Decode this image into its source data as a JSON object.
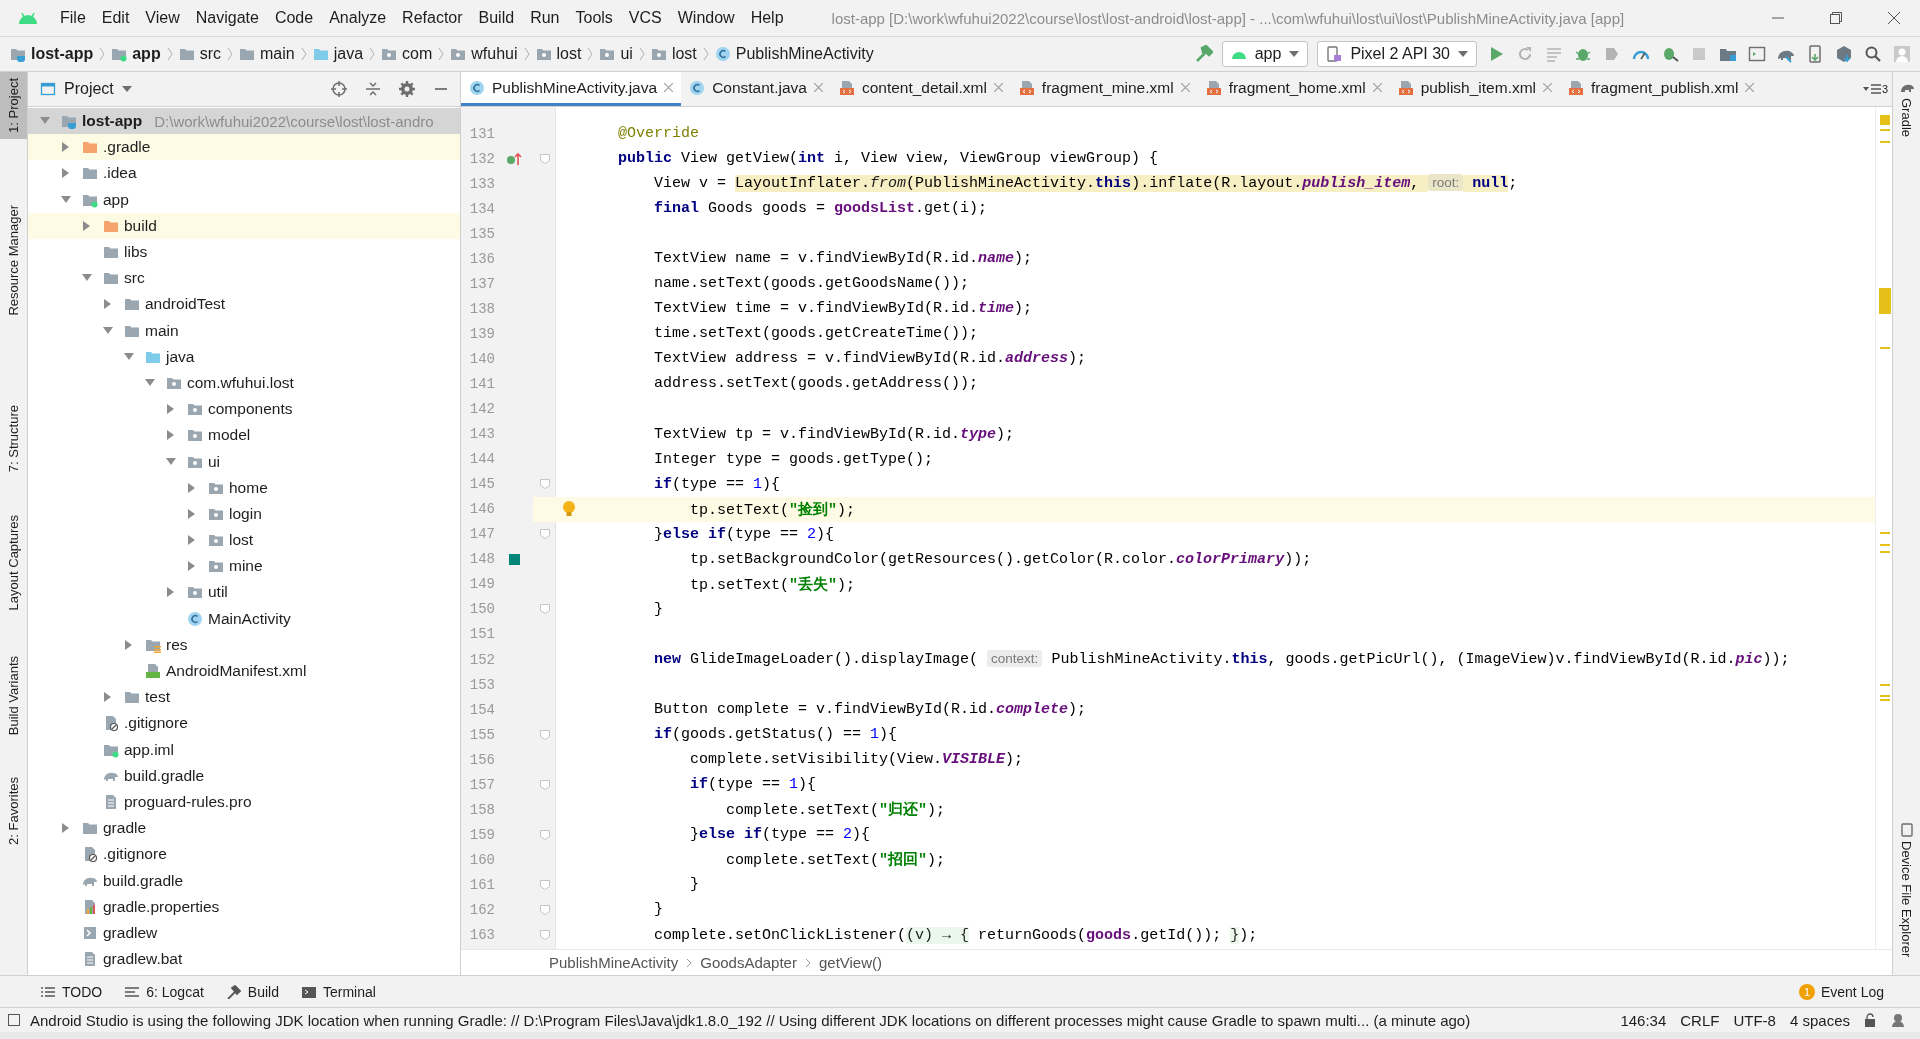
{
  "menu_bar": {
    "items": [
      "File",
      "Edit",
      "View",
      "Navigate",
      "Code",
      "Analyze",
      "Refactor",
      "Build",
      "Run",
      "Tools",
      "VCS",
      "Window",
      "Help"
    ],
    "title": "lost-app [D:\\work\\wfuhui2022\\course\\lost\\lost-android\\lost-app] - ...\\com\\wfuhui\\lost\\ui\\lost\\PublishMineActivity.java [app]"
  },
  "nav_bar": {
    "crumbs": [
      {
        "label": "lost-app",
        "kind": "module-root"
      },
      {
        "label": "app",
        "kind": "module"
      },
      {
        "label": "src",
        "kind": "folder"
      },
      {
        "label": "main",
        "kind": "folder"
      },
      {
        "label": "java",
        "kind": "source"
      },
      {
        "label": "com",
        "kind": "package"
      },
      {
        "label": "wfuhui",
        "kind": "package"
      },
      {
        "label": "lost",
        "kind": "package"
      },
      {
        "label": "ui",
        "kind": "package"
      },
      {
        "label": "lost",
        "kind": "package"
      },
      {
        "label": "PublishMineActivity",
        "kind": "class"
      }
    ],
    "run_config": "app",
    "device": "Pixel 2 API 30"
  },
  "left_stripe": [
    {
      "label": "1: Project",
      "selected": true
    },
    {
      "label": "Resource Manager",
      "selected": false
    },
    {
      "label": "7: Structure",
      "selected": false
    },
    {
      "label": "Layout Captures",
      "selected": false
    },
    {
      "label": "Build Variants",
      "selected": false
    },
    {
      "label": "2: Favorites",
      "selected": false
    }
  ],
  "project_panel": {
    "title": "Project",
    "tree": [
      {
        "label": "lost-app",
        "path": "D:\\work\\wfuhui2022\\course\\lost\\lost-andro",
        "kind": "module-root",
        "expanded": true,
        "selected": true,
        "children": [
          {
            "label": ".gradle",
            "kind": "excluded",
            "expanded": false,
            "selected": false
          },
          {
            "label": ".idea",
            "kind": "folder",
            "expanded": false,
            "selected": false
          },
          {
            "label": "app",
            "kind": "module",
            "expanded": true,
            "selected": false,
            "children": [
              {
                "label": "build",
                "kind": "excluded",
                "expanded": false,
                "selected": false
              },
              {
                "label": "libs",
                "kind": "folder",
                "selected": false
              },
              {
                "label": "src",
                "kind": "folder",
                "expanded": true,
                "selected": false,
                "children": [
                  {
                    "label": "androidTest",
                    "kind": "folder",
                    "expanded": false,
                    "selected": false
                  },
                  {
                    "label": "main",
                    "kind": "folder",
                    "expanded": true,
                    "selected": false,
                    "children": [
                      {
                        "label": "java",
                        "kind": "source",
                        "expanded": true,
                        "selected": false,
                        "children": [
                          {
                            "label": "com.wfuhui.lost",
                            "kind": "package",
                            "expanded": true,
                            "selected": false,
                            "children": [
                              {
                                "label": "components",
                                "kind": "package",
                                "expanded": false,
                                "selected": false
                              },
                              {
                                "label": "model",
                                "kind": "package",
                                "expanded": false,
                                "selected": false
                              },
                              {
                                "label": "ui",
                                "kind": "package",
                                "expanded": true,
                                "selected": false,
                                "children": [
                                  {
                                    "label": "home",
                                    "kind": "package",
                                    "expanded": false,
                                    "selected": false
                                  },
                                  {
                                    "label": "login",
                                    "kind": "package",
                                    "expanded": false,
                                    "selected": false
                                  },
                                  {
                                    "label": "lost",
                                    "kind": "package",
                                    "expanded": false,
                                    "selected": false
                                  },
                                  {
                                    "label": "mine",
                                    "kind": "package",
                                    "expanded": false,
                                    "selected": false
                                  }
                                ]
                              },
                              {
                                "label": "util",
                                "kind": "package",
                                "expanded": false,
                                "selected": false
                              },
                              {
                                "label": "MainActivity",
                                "kind": "class",
                                "selected": false
                              }
                            ]
                          }
                        ]
                      },
                      {
                        "label": "res",
                        "kind": "res",
                        "expanded": false,
                        "selected": false
                      },
                      {
                        "label": "AndroidManifest.xml",
                        "kind": "manifest",
                        "selected": false
                      }
                    ]
                  },
                  {
                    "label": "test",
                    "kind": "folder",
                    "expanded": false,
                    "selected": false
                  }
                ]
              },
              {
                "label": ".gitignore",
                "kind": "gitignore",
                "selected": false
              },
              {
                "label": "app.iml",
                "kind": "iml",
                "selected": false
              },
              {
                "label": "build.gradle",
                "kind": "gradle",
                "selected": false
              },
              {
                "label": "proguard-rules.pro",
                "kind": "text",
                "selected": false
              }
            ]
          },
          {
            "label": "gradle",
            "kind": "folder",
            "expanded": false,
            "selected": false
          },
          {
            "label": ".gitignore",
            "kind": "gitignore",
            "selected": false
          },
          {
            "label": "build.gradle",
            "kind": "gradle",
            "selected": false
          },
          {
            "label": "gradle.properties",
            "kind": "properties",
            "selected": false
          },
          {
            "label": "gradlew",
            "kind": "script",
            "selected": false
          },
          {
            "label": "gradlew.bat",
            "kind": "text",
            "selected": false
          }
        ]
      }
    ]
  },
  "editor": {
    "tabs": [
      {
        "label": "PublishMineActivity.java",
        "kind": "class",
        "selected": true
      },
      {
        "label": "Constant.java",
        "kind": "class",
        "selected": false
      },
      {
        "label": "content_detail.xml",
        "kind": "xml",
        "selected": false
      },
      {
        "label": "fragment_mine.xml",
        "kind": "xml",
        "selected": false
      },
      {
        "label": "fragment_home.xml",
        "kind": "xml",
        "selected": false
      },
      {
        "label": "publish_item.xml",
        "kind": "xml",
        "selected": false
      },
      {
        "label": "fragment_publish.xml",
        "kind": "xml",
        "selected": false
      }
    ],
    "tab_overflow": "3",
    "lines": [
      {
        "number": "131",
        "tokens": [
          {
            "kind": "annotation",
            "text": "    @Override"
          }
        ]
      },
      {
        "number": "132",
        "gutter_icon": {
          "kind": "override"
        },
        "fold": true,
        "tokens": [
          {
            "kind": "keyword",
            "text": "    public"
          },
          {
            "kind": "plain",
            "text": " View getView("
          },
          {
            "kind": "keyword",
            "text": "int"
          },
          {
            "kind": "plain",
            "text": " i, View view, ViewGroup viewGroup) {"
          }
        ]
      },
      {
        "number": "133",
        "tokens": [
          {
            "kind": "plain",
            "text": "        View v = "
          },
          {
            "kind": "plain",
            "text": "LayoutInflater.",
            "highlighted": true
          },
          {
            "kind": "method",
            "text": "from",
            "highlighted": true
          },
          {
            "kind": "plain",
            "text": "(PublishMineActivity.",
            "highlighted": true
          },
          {
            "kind": "keyword",
            "text": "this",
            "highlighted": true
          },
          {
            "kind": "plain",
            "text": ").inflate(R.layout.",
            "highlighted": true
          },
          {
            "kind": "static_field",
            "text": "publish_item",
            "highlighted": true
          },
          {
            "kind": "plain",
            "text": ", ",
            "highlighted": true
          },
          {
            "kind": "hint",
            "text": "root:",
            "highlighted": true
          },
          {
            "kind": "keyword",
            "text": " null",
            "highlighted": true
          },
          {
            "kind": "plain",
            "text": ";"
          }
        ]
      },
      {
        "number": "134",
        "tokens": [
          {
            "kind": "keyword",
            "text": "        final"
          },
          {
            "kind": "plain",
            "text": " Goods goods = "
          },
          {
            "kind": "field",
            "text": "goodsList"
          },
          {
            "kind": "plain",
            "text": ".get(i);"
          }
        ]
      },
      {
        "number": "135"
      },
      {
        "number": "136",
        "tokens": [
          {
            "kind": "plain",
            "text": "        TextView name = v.findViewById(R.id."
          },
          {
            "kind": "static_field",
            "text": "name"
          },
          {
            "kind": "plain",
            "text": ");"
          }
        ]
      },
      {
        "number": "137",
        "tokens": [
          {
            "kind": "plain",
            "text": "        name.setText(goods.getGoodsName());"
          }
        ]
      },
      {
        "number": "138",
        "tokens": [
          {
            "kind": "plain",
            "text": "        TextView time = v.findViewById(R.id."
          },
          {
            "kind": "static_field",
            "text": "time"
          },
          {
            "kind": "plain",
            "text": ");"
          }
        ]
      },
      {
        "number": "139",
        "tokens": [
          {
            "kind": "plain",
            "text": "        time.setText(goods.getCreateTime());"
          }
        ]
      },
      {
        "number": "140",
        "tokens": [
          {
            "kind": "plain",
            "text": "        TextView address = v.findViewById(R.id."
          },
          {
            "kind": "static_field",
            "text": "address"
          },
          {
            "kind": "plain",
            "text": ");"
          }
        ]
      },
      {
        "number": "141",
        "tokens": [
          {
            "kind": "plain",
            "text": "        address.setText(goods.getAddress());"
          }
        ]
      },
      {
        "number": "142"
      },
      {
        "number": "143",
        "tokens": [
          {
            "kind": "plain",
            "text": "        TextView tp = v.findViewById(R.id."
          },
          {
            "kind": "static_field",
            "text": "type"
          },
          {
            "kind": "plain",
            "text": ");"
          }
        ]
      },
      {
        "number": "144",
        "tokens": [
          {
            "kind": "plain",
            "text": "        Integer type = goods.getType();"
          }
        ]
      },
      {
        "number": "145",
        "fold": true,
        "tokens": [
          {
            "kind": "keyword",
            "text": "        if"
          },
          {
            "kind": "plain",
            "text": "(type == "
          },
          {
            "kind": "number",
            "text": "1"
          },
          {
            "kind": "plain",
            "text": "){"
          }
        ]
      },
      {
        "number": "146",
        "gutter_icon": {
          "kind": "bulb"
        },
        "current": true,
        "tokens": [
          {
            "kind": "plain",
            "text": "            tp.setText("
          },
          {
            "kind": "string",
            "text": "\"捡到\""
          },
          {
            "kind": "plain",
            "text": ");"
          }
        ]
      },
      {
        "number": "147",
        "fold": true,
        "tokens": [
          {
            "kind": "plain",
            "text": "        }"
          },
          {
            "kind": "keyword",
            "text": "else if"
          },
          {
            "kind": "plain",
            "text": "(type == "
          },
          {
            "kind": "number",
            "text": "2"
          },
          {
            "kind": "plain",
            "text": "){"
          }
        ]
      },
      {
        "number": "148",
        "gutter_icon": {
          "kind": "swatch"
        },
        "tokens": [
          {
            "kind": "plain",
            "text": "            tp.setBackgroundColor(getResources().getColor(R.color."
          },
          {
            "kind": "static_field",
            "text": "colorPrimary"
          },
          {
            "kind": "plain",
            "text": "));"
          }
        ]
      },
      {
        "number": "149",
        "tokens": [
          {
            "kind": "plain",
            "text": "            tp.setText("
          },
          {
            "kind": "string",
            "text": "\"丢失\""
          },
          {
            "kind": "plain",
            "text": ");"
          }
        ]
      },
      {
        "number": "150",
        "fold": true,
        "tokens": [
          {
            "kind": "plain",
            "text": "        }"
          }
        ]
      },
      {
        "number": "151"
      },
      {
        "number": "152",
        "tokens": [
          {
            "kind": "keyword",
            "text": "        new"
          },
          {
            "kind": "plain",
            "text": " GlideImageLoader().displayImage( "
          },
          {
            "kind": "hint",
            "text": "context:"
          },
          {
            "kind": "plain",
            "text": " PublishMineActivity."
          },
          {
            "kind": "keyword",
            "text": "this"
          },
          {
            "kind": "plain",
            "text": ", goods.getPicUrl(), (ImageView)v.findViewById(R.id."
          },
          {
            "kind": "static_field",
            "text": "pic"
          },
          {
            "kind": "plain",
            "text": "));"
          }
        ]
      },
      {
        "number": "153"
      },
      {
        "number": "154",
        "tokens": [
          {
            "kind": "plain",
            "text": "        Button complete = v.findViewById(R.id."
          },
          {
            "kind": "static_field",
            "text": "complete"
          },
          {
            "kind": "plain",
            "text": ");"
          }
        ]
      },
      {
        "number": "155",
        "fold": true,
        "tokens": [
          {
            "kind": "keyword",
            "text": "        if"
          },
          {
            "kind": "plain",
            "text": "(goods.getStatus() == "
          },
          {
            "kind": "number",
            "text": "1"
          },
          {
            "kind": "plain",
            "text": "){"
          }
        ]
      },
      {
        "number": "156",
        "tokens": [
          {
            "kind": "plain",
            "text": "            complete.setVisibility(View."
          },
          {
            "kind": "static_field",
            "text": "VISIBLE"
          },
          {
            "kind": "plain",
            "text": ");"
          }
        ]
      },
      {
        "number": "157",
        "fold": true,
        "tokens": [
          {
            "kind": "keyword",
            "text": "            if"
          },
          {
            "kind": "plain",
            "text": "(type == "
          },
          {
            "kind": "number",
            "text": "1"
          },
          {
            "kind": "plain",
            "text": "){"
          }
        ]
      },
      {
        "number": "158",
        "tokens": [
          {
            "kind": "plain",
            "text": "                complete.setText("
          },
          {
            "kind": "string",
            "text": "\"归还\""
          },
          {
            "kind": "plain",
            "text": ");"
          }
        ]
      },
      {
        "number": "159",
        "fold": true,
        "tokens": [
          {
            "kind": "plain",
            "text": "            }"
          },
          {
            "kind": "keyword",
            "text": "else if"
          },
          {
            "kind": "plain",
            "text": "(type == "
          },
          {
            "kind": "number",
            "text": "2"
          },
          {
            "kind": "plain",
            "text": "){"
          }
        ]
      },
      {
        "number": "160",
        "tokens": [
          {
            "kind": "plain",
            "text": "                complete.setText("
          },
          {
            "kind": "string",
            "text": "\"招回\""
          },
          {
            "kind": "plain",
            "text": ");"
          }
        ]
      },
      {
        "number": "161",
        "fold": true,
        "tokens": [
          {
            "kind": "plain",
            "text": "            }"
          }
        ]
      },
      {
        "number": "162",
        "fold": true,
        "tokens": [
          {
            "kind": "plain",
            "text": "        }"
          }
        ]
      },
      {
        "number": "163",
        "fold": true,
        "tokens": [
          {
            "kind": "plain",
            "text": "        complete.setOnClickListener("
          },
          {
            "kind": "lambda",
            "text": "(v) → {"
          },
          {
            "kind": "plain",
            "text": " returnGoods("
          },
          {
            "kind": "field",
            "text": "goods"
          },
          {
            "kind": "plain",
            "text": ".getId()); "
          },
          {
            "kind": "lambda",
            "text": "}"
          },
          {
            "kind": "plain",
            "text": ");"
          }
        ]
      }
    ],
    "breadcrumbs": [
      "PublishMineActivity",
      "GoodsAdapter",
      "getView()"
    ]
  },
  "right_stripe": [
    "Gradle",
    "Device File Explorer"
  ],
  "tool_strip": {
    "items": [
      "TODO",
      "6: Logcat",
      "Build",
      "Terminal"
    ],
    "event_badge": "1",
    "event_log": "Event Log"
  },
  "status_bar": {
    "message": "Android Studio is using the following JDK location when running Gradle: // D:\\Program Files\\Java\\jdk1.8.0_192 // Using different JDK locations on different processes might cause Gradle to spawn multi... (a minute ago)",
    "position": "146:34",
    "line_ending": "CRLF",
    "encoding": "UTF-8",
    "indent": "4 spaces"
  }
}
